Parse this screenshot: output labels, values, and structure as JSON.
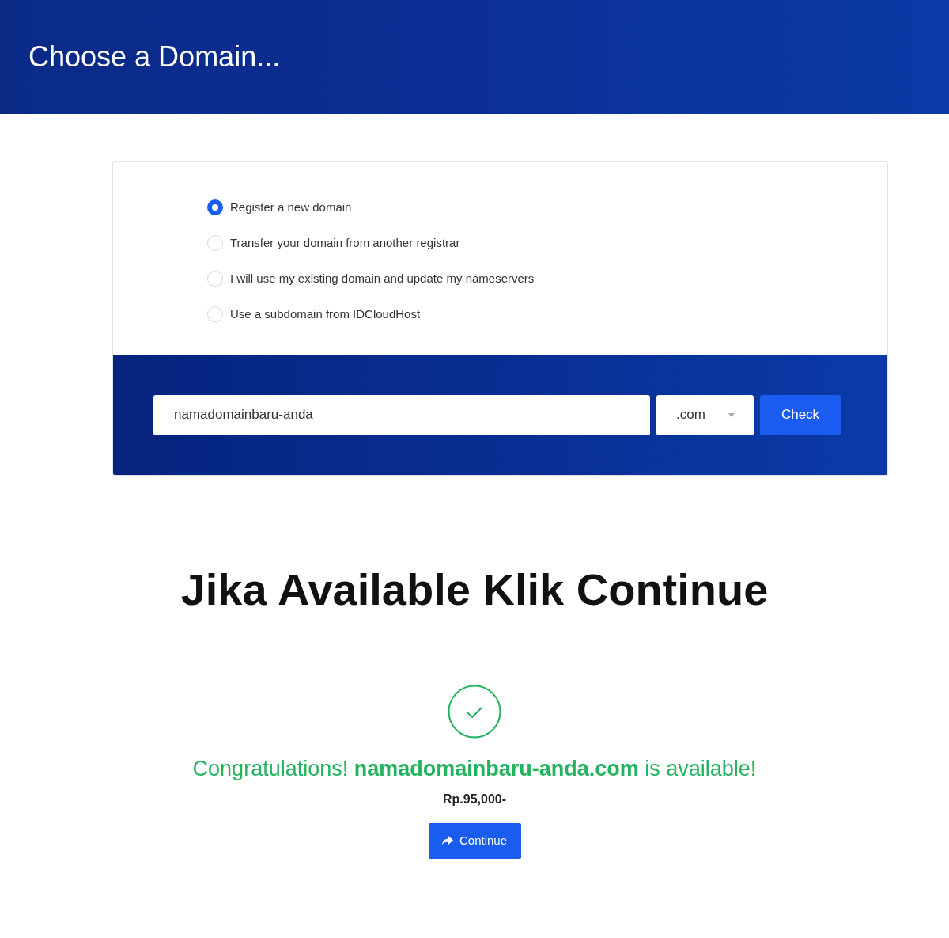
{
  "header": {
    "title": "Choose a Domain..."
  },
  "options": [
    {
      "label": "Register a new domain",
      "selected": true
    },
    {
      "label": "Transfer your domain from another registrar",
      "selected": false
    },
    {
      "label": "I will use my existing domain and update my nameservers",
      "selected": false
    },
    {
      "label": "Use a subdomain from IDCloudHost",
      "selected": false
    }
  ],
  "search": {
    "value": "namadomainbaru-anda",
    "tld": ".com",
    "button": "Check"
  },
  "heading": "Jika Available Klik Continue",
  "result": {
    "message": "Congratulations! **namadomainbaru-anda.com** is available!",
    "price": "Rp.95,000-",
    "button": "Continue"
  }
}
